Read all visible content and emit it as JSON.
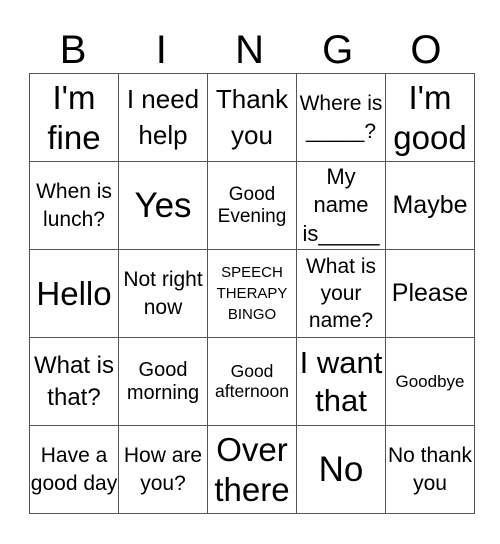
{
  "header": {
    "letters": [
      "B",
      "I",
      "N",
      "G",
      "O"
    ]
  },
  "board": {
    "rows": [
      [
        {
          "text": "I'm fine"
        },
        {
          "text": "I need help"
        },
        {
          "text": "Thank you"
        },
        {
          "text": "Where is _____?"
        },
        {
          "text": "I'm good"
        }
      ],
      [
        {
          "text": "When is lunch?"
        },
        {
          "text": "Yes"
        },
        {
          "text": "Good Evening"
        },
        {
          "text": "My name is_____"
        },
        {
          "text": "Maybe"
        }
      ],
      [
        {
          "text": "Hello"
        },
        {
          "text": "Not right now"
        },
        {
          "text": "SPEECH THERAPY BINGO",
          "free_space": true
        },
        {
          "text": "What is your name?"
        },
        {
          "text": "Please"
        }
      ],
      [
        {
          "text": "What is that?"
        },
        {
          "text": "Good morning"
        },
        {
          "text": "Good afternoon"
        },
        {
          "text": "I want that"
        },
        {
          "text": "Goodbye"
        }
      ],
      [
        {
          "text": "Have a good day"
        },
        {
          "text": "How are you?"
        },
        {
          "text": "Over there"
        },
        {
          "text": "No"
        },
        {
          "text": "No thank you"
        }
      ]
    ]
  }
}
